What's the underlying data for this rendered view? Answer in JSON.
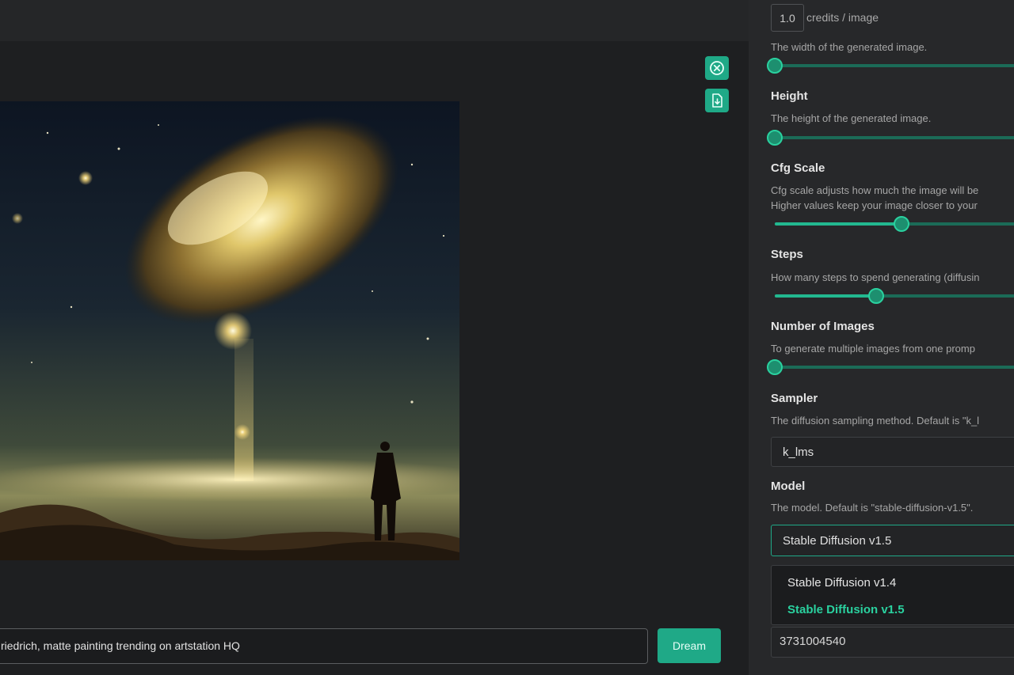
{
  "colors": {
    "accent": "#1fa987",
    "background": "#1e1f21",
    "panel": "#27282a"
  },
  "actions": {
    "cancel_icon": "x-circle-icon",
    "download_icon": "file-download-icon"
  },
  "credits": {
    "value": "1.0",
    "label": "credits / image"
  },
  "settings": {
    "width_desc": "The width of the generated image.",
    "width_level": 0,
    "height_label": "Height",
    "height_desc": "The height of the generated image.",
    "height_level": 0,
    "cfg_label": "Cfg Scale",
    "cfg_desc_1": "Cfg scale adjusts how much the image will be",
    "cfg_desc_2": "Higher values keep your image closer to your",
    "cfg_level": 0.5,
    "steps_label": "Steps",
    "steps_desc": "How many steps to spend generating (diffusin",
    "steps_level": 0.4,
    "images_label": "Number of Images",
    "images_desc": "To generate multiple images from one promp",
    "images_level": 0,
    "sampler_label": "Sampler",
    "sampler_desc": "The diffusion sampling method. Default is \"k_l",
    "sampler_value": "k_lms",
    "model_label": "Model",
    "model_desc": "The model. Default is \"stable-diffusion-v1.5\".",
    "model_value": "Stable Diffusion v1.5",
    "model_options": [
      "Stable Diffusion v1.4",
      "Stable Diffusion v1.5"
    ],
    "seed_value": "3731004540"
  },
  "prompt": {
    "text": "riedrich, matte painting trending on artstation HQ",
    "button": "Dream"
  }
}
